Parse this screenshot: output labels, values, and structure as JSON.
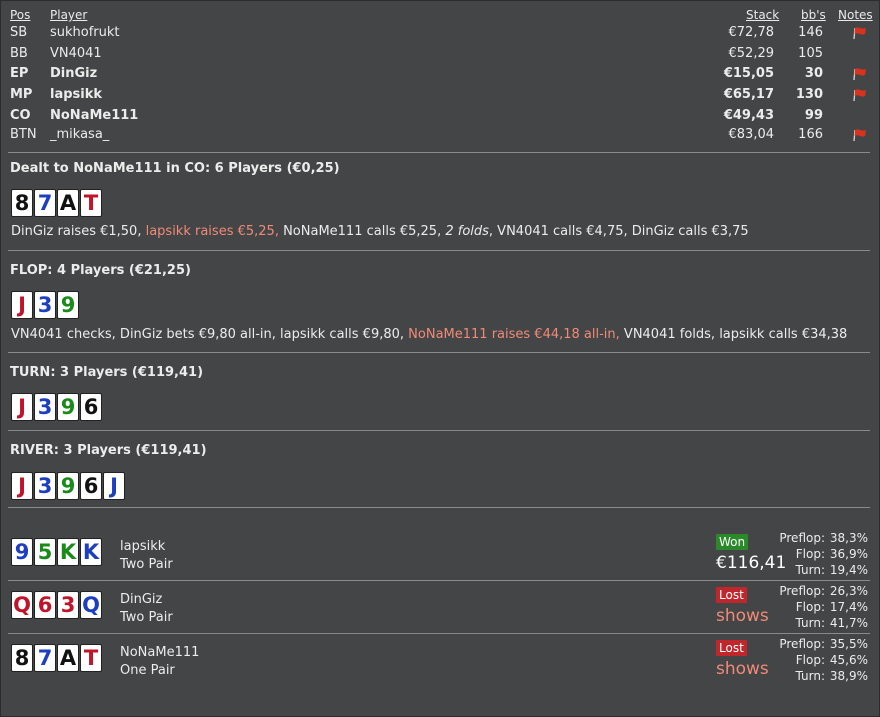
{
  "headers": {
    "pos": "Pos",
    "player": "Player",
    "stack": "Stack",
    "bbs": "bb's",
    "notes": "Notes"
  },
  "players": [
    {
      "pos": "SB",
      "name": "sukhofrukt",
      "stack": "€72,78",
      "bbs": "146",
      "flag": true,
      "bold": false
    },
    {
      "pos": "BB",
      "name": "VN4041",
      "stack": "€52,29",
      "bbs": "105",
      "flag": false,
      "bold": false
    },
    {
      "pos": "EP",
      "name": "DinGiz",
      "stack": "€15,05",
      "bbs": "30",
      "flag": true,
      "bold": true
    },
    {
      "pos": "MP",
      "name": "lapsikk",
      "stack": "€65,17",
      "bbs": "130",
      "flag": true,
      "bold": true
    },
    {
      "pos": "CO",
      "name": "NoNaMe111",
      "stack": "€49,43",
      "bbs": "99",
      "flag": false,
      "bold": true
    },
    {
      "pos": "BTN",
      "name": "_mikasa_",
      "stack": "€83,04",
      "bbs": "166",
      "flag": true,
      "bold": false
    }
  ],
  "preflop": {
    "title": "Dealt to NoNaMe111 in CO: 6 Players (€0,25)",
    "cards": [
      {
        "r": "8",
        "s": "black"
      },
      {
        "r": "7",
        "s": "blue"
      },
      {
        "r": "A",
        "s": "black"
      },
      {
        "r": "T",
        "s": "red"
      }
    ],
    "a1": "DinGiz raises €1,50, ",
    "a2": "lapsikk raises €5,25, ",
    "a3": "NoNaMe111 calls €5,25, ",
    "a4": "2 folds",
    "a5": ", VN4041 calls €4,75, DinGiz calls €3,75"
  },
  "flop": {
    "title": "FLOP: 4 Players (€21,25)",
    "cards": [
      {
        "r": "J",
        "s": "red"
      },
      {
        "r": "3",
        "s": "blue"
      },
      {
        "r": "9",
        "s": "green"
      }
    ],
    "a1": "VN4041 checks, DinGiz bets €9,80 all-in, lapsikk calls €9,80, ",
    "a2": "NoNaMe111 raises €44,18 all-in, ",
    "a3": "VN4041 folds, lapsikk calls €34,38"
  },
  "turn": {
    "title": "TURN: 3 Players (€119,41)",
    "cards": [
      {
        "r": "J",
        "s": "red"
      },
      {
        "r": "3",
        "s": "blue"
      },
      {
        "r": "9",
        "s": "green"
      },
      {
        "r": "6",
        "s": "black"
      }
    ]
  },
  "river": {
    "title": "RIVER: 3 Players (€119,41)",
    "cards": [
      {
        "r": "J",
        "s": "red"
      },
      {
        "r": "3",
        "s": "blue"
      },
      {
        "r": "9",
        "s": "green"
      },
      {
        "r": "6",
        "s": "black"
      },
      {
        "r": "J",
        "s": "blue"
      }
    ]
  },
  "showdown": [
    {
      "name": "lapsikk",
      "hand": "Two Pair",
      "result": "Won",
      "amount": "€116,41",
      "cards": [
        {
          "r": "9",
          "s": "blue"
        },
        {
          "r": "5",
          "s": "green"
        },
        {
          "r": "K",
          "s": "green"
        },
        {
          "r": "K",
          "s": "blue"
        }
      ],
      "equity": {
        "preflop": "38,3%",
        "flop": "36,9%",
        "turn": "19,4%"
      }
    },
    {
      "name": "DinGiz",
      "hand": "Two Pair",
      "result": "Lost",
      "amount": "shows",
      "cards": [
        {
          "r": "Q",
          "s": "red"
        },
        {
          "r": "6",
          "s": "red"
        },
        {
          "r": "3",
          "s": "red"
        },
        {
          "r": "Q",
          "s": "blue"
        }
      ],
      "equity": {
        "preflop": "26,3%",
        "flop": "17,4%",
        "turn": "41,7%"
      }
    },
    {
      "name": "NoNaMe111",
      "hand": "One Pair",
      "result": "Lost",
      "amount": "shows",
      "cards": [
        {
          "r": "8",
          "s": "black"
        },
        {
          "r": "7",
          "s": "blue"
        },
        {
          "r": "A",
          "s": "black"
        },
        {
          "r": "T",
          "s": "red"
        }
      ],
      "equity": {
        "preflop": "35,5%",
        "flop": "45,6%",
        "turn": "38,9%"
      }
    }
  ],
  "equity_labels": {
    "preflop": "Preflop:",
    "flop": "Flop:",
    "turn": "Turn:"
  },
  "icons": {
    "notes_flag": "red-flag-icon"
  },
  "colors": {
    "background": "#444546",
    "highlight": "#f08a78",
    "won": "#2a8a2a",
    "lost": "#c0272d"
  }
}
